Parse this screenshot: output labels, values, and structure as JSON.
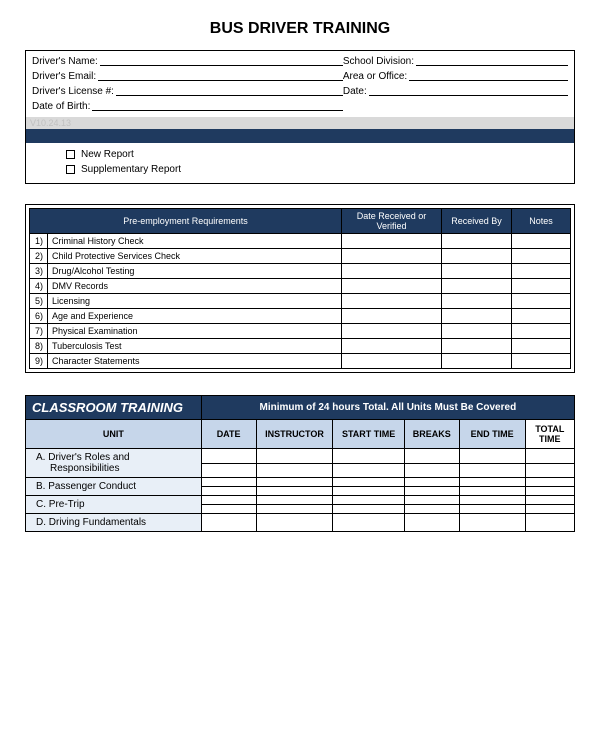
{
  "title": "BUS DRIVER TRAINING",
  "info": {
    "name": "Driver's Name:",
    "email": "Driver's Email:",
    "license": "Driver's License #:",
    "dob": "Date of Birth:",
    "division": "School Division:",
    "area": "Area or Office:",
    "date": "Date:",
    "watermark": "V10.24.13",
    "check_new": "New Report",
    "check_supp": "Supplementary Report"
  },
  "req": {
    "headers": {
      "name": "Pre-employment Requirements",
      "date": "Date Received or Verified",
      "recv": "Received By",
      "notes": "Notes"
    },
    "rows": [
      {
        "n": "1)",
        "label": "Criminal History Check"
      },
      {
        "n": "2)",
        "label": "Child Protective Services Check"
      },
      {
        "n": "3)",
        "label": "Drug/Alcohol Testing"
      },
      {
        "n": "4)",
        "label": "DMV Records"
      },
      {
        "n": "5)",
        "label": "Licensing"
      },
      {
        "n": "6)",
        "label": "Age and Experience"
      },
      {
        "n": "7)",
        "label": "Physical Examination"
      },
      {
        "n": "8)",
        "label": "Tuberculosis Test"
      },
      {
        "n": "9)",
        "label": "Character Statements"
      }
    ]
  },
  "cls": {
    "title": "CLASSROOM TRAINING",
    "subtitle": "Minimum of 24 hours Total.  All Units Must Be Covered",
    "cols": {
      "unit": "UNIT",
      "date": "DATE",
      "inst": "INSTRUCTOR",
      "start": "START TIME",
      "breaks": "BREAKS",
      "end": "END TIME",
      "total": "TOTAL TIME"
    },
    "units": [
      {
        "label": "A.  Driver's Roles and Responsibilities",
        "rows": 2
      },
      {
        "label": "B.  Passenger Conduct",
        "rows": 2
      },
      {
        "label": "C.  Pre-Trip",
        "rows": 2
      },
      {
        "label": "D.  Driving Fundamentals",
        "rows": 1
      }
    ]
  }
}
